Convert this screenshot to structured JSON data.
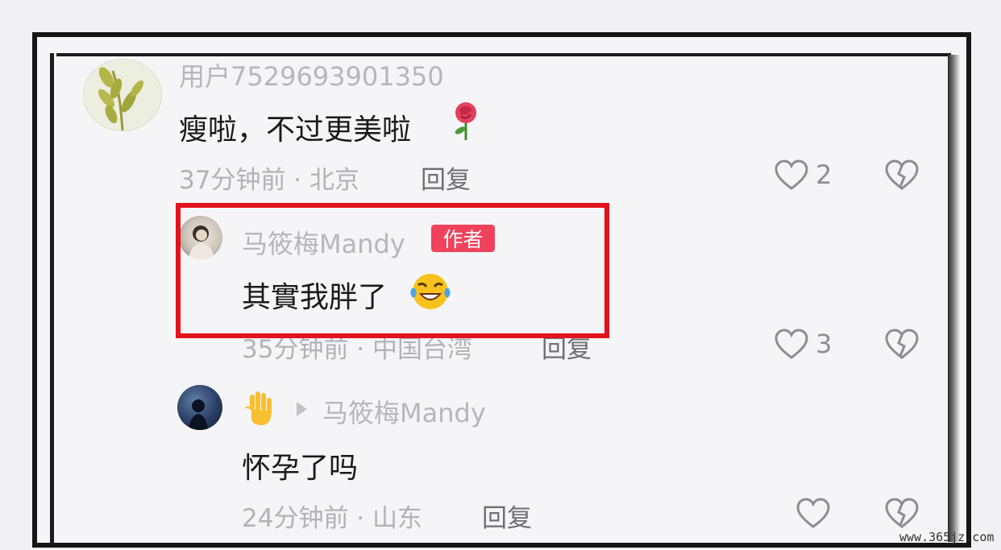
{
  "comments": [
    {
      "username": "用户7529693901350",
      "text": "瘦啦，不过更美啦",
      "time_location": "37分钟前 · 北京",
      "reply_label": "回复",
      "like_count": "2",
      "emoji": "rose"
    },
    {
      "username": "马筱梅Mandy",
      "badge": "作者",
      "text": "其實我胖了",
      "time_location": "35分钟前 · 中国台湾",
      "reply_label": "回复",
      "like_count": "3",
      "emoji": "laughing-tears"
    },
    {
      "username_emoji": "raised-hand",
      "reply_to": "马筱梅Mandy",
      "text": "怀孕了吗",
      "time_location": "24分钟前 · 山东",
      "reply_label": "回复",
      "like_count": "",
      "emoji": ""
    }
  ],
  "highlight_color": "#e3121c",
  "badge_color": "#f0425c",
  "watermark": "www.365jz.com"
}
